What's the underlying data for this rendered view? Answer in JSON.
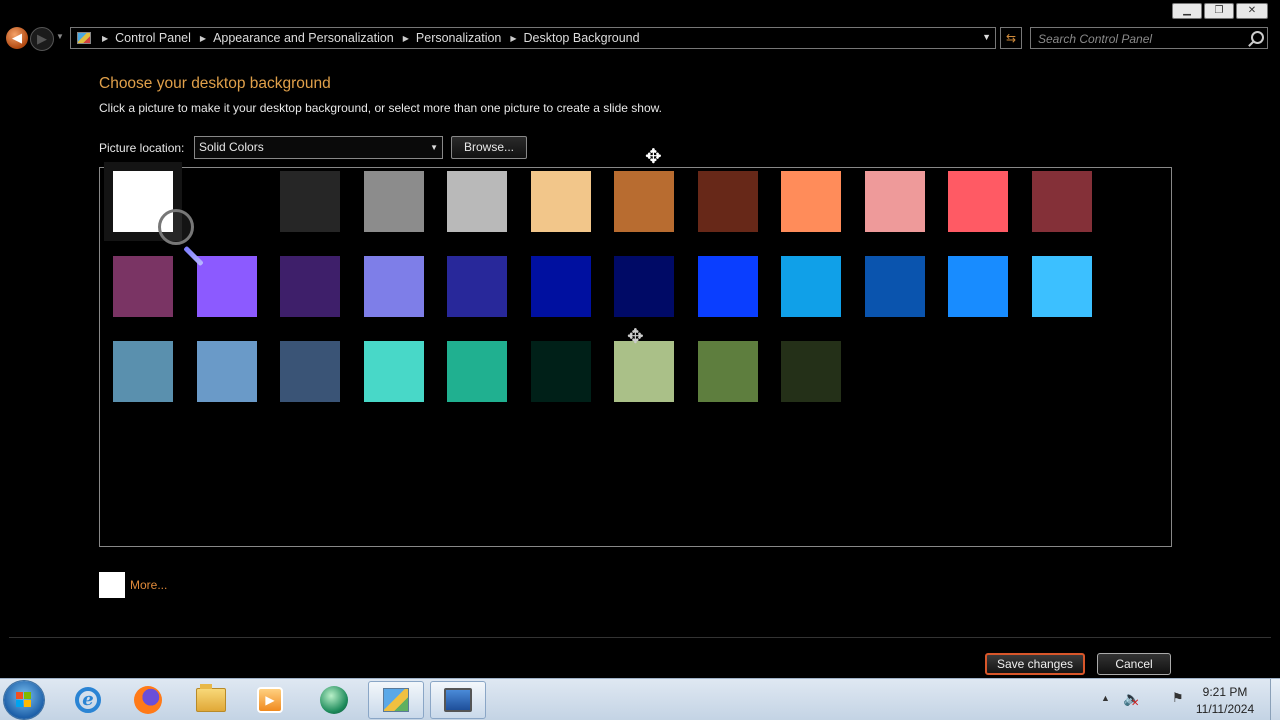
{
  "window": {
    "breadcrumbs": [
      "Control Panel",
      "Appearance and Personalization",
      "Personalization",
      "Desktop Background"
    ],
    "search_placeholder": "Search Control Panel"
  },
  "content": {
    "title": "Choose your desktop background",
    "subtitle": "Click a picture to make it your desktop background, or select more than one picture to create a slide show.",
    "location_label": "Picture location:",
    "location_value": "Solid Colors",
    "browse_label": "Browse...",
    "more_label": "More...",
    "more_color": "#ffffff"
  },
  "swatches": [
    [
      "#ffffff",
      "#000000",
      "#262626",
      "#8c8c8c",
      "#b9b9b9",
      "#f2c68a",
      "#b86c30",
      "#672818",
      "#ff8c5a",
      "#ee9a9a",
      "#ff5a64",
      "#843038"
    ],
    [
      "#7a3464",
      "#8c5aff",
      "#3e1f6a",
      "#7e7ee8",
      "#28289a",
      "#0010a0",
      "#000a66",
      "#0a3eff",
      "#10a0e8",
      "#0a54ae",
      "#188cff",
      "#3cc0ff"
    ],
    [
      "#5a90ae",
      "#6a9ac8",
      "#3a5476",
      "#48d8c8",
      "#20b090",
      "#002018",
      "#aac088",
      "#5e7e3e",
      "#243018"
    ]
  ],
  "selected_swatch": [
    0,
    0
  ],
  "actions": {
    "save_label": "Save changes",
    "cancel_label": "Cancel"
  },
  "taskbar": {
    "time": "9:21 PM",
    "date": "11/11/2024"
  }
}
